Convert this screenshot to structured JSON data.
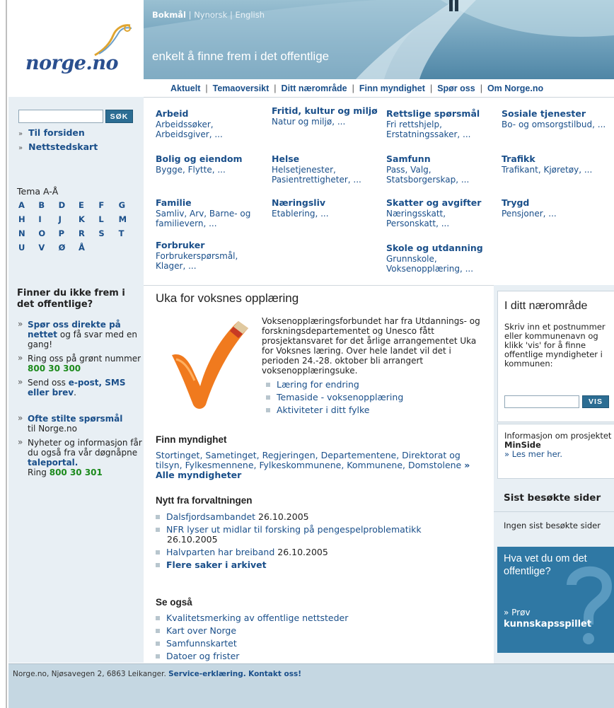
{
  "header": {
    "logo_text": "norge.no",
    "languages": [
      {
        "label": "Bokmål",
        "active": true
      },
      {
        "label": "Nynorsk",
        "active": false
      },
      {
        "label": "English",
        "active": false
      }
    ],
    "lang_sep": "|",
    "tagline": "enkelt å finne frem i det offentlige",
    "nav": [
      "Aktuelt",
      "Temaoversikt",
      "Ditt nærområde",
      "Finn myndighet",
      "Spør oss",
      "Om Norge.no"
    ],
    "nav_sep": "|"
  },
  "sidebar": {
    "search_button": "SØK",
    "search_placeholder": "",
    "links": [
      "Til forsiden",
      "Nettstedskart"
    ],
    "link_bullet": "»",
    "tema_title": "Tema A-Å",
    "letters": [
      "A",
      "B",
      "D",
      "E",
      "F",
      "G",
      "H",
      "I",
      "J",
      "K",
      "L",
      "M",
      "N",
      "O",
      "P",
      "R",
      "S",
      "T",
      "U",
      "V",
      "Ø",
      "Å"
    ],
    "finner_title": "Finner du ikke frem i det offentlige?",
    "help1_link": "Spør oss direkte på nettet",
    "help1_text": " og få svar med en gang!",
    "help2_text": "Ring oss på grønt nummer ",
    "help2_num": "800 30 300",
    "help3_text": "Send oss ",
    "help3_link": "e-post, SMS eller brev",
    "help3_end": ".",
    "faq_link": "Ofte stilte spørsmål",
    "faq_text": "til Norge.no",
    "news_text": "Nyheter og informasjon får du også fra vår døgnåpne ",
    "news_link": "taleportal.",
    "news_ring": "Ring ",
    "news_num": "800 30 301"
  },
  "topics": [
    {
      "title": "Arbeid",
      "sub": "Arbeidssøker, Arbeidsgiver, ..."
    },
    {
      "title": "Fritid, kultur og miljø",
      "sub": "Natur og miljø, ..."
    },
    {
      "title": "Rettslige spørsmål",
      "sub": "Fri rettshjelp, Erstatningssaker, ..."
    },
    {
      "title": "Sosiale tjenester",
      "sub": "Bo- og omsorgstilbud, ..."
    },
    {
      "title": "Bolig og eiendom",
      "sub": "Bygge, Flytte, ..."
    },
    {
      "title": "Helse",
      "sub": "Helsetjenester, Pasientrettigheter, ..."
    },
    {
      "title": "Samfunn",
      "sub": "Pass, Valg, Statsborgerskap, ..."
    },
    {
      "title": "Trafikk",
      "sub": "Trafikant, Kjøretøy, ..."
    },
    {
      "title": "Familie",
      "sub": "Samliv, Arv, Barne- og familievern, ..."
    },
    {
      "title": "Næringsliv",
      "sub": "Etablering, ..."
    },
    {
      "title": "Skatter og avgifter",
      "sub": "Næringsskatt, Personskatt, ..."
    },
    {
      "title": "Trygd",
      "sub": "Pensjoner, ..."
    },
    {
      "title": "Forbruker",
      "sub": "Forbrukerspørsmål, Klager, ..."
    },
    {
      "title": "Skole og utdanning",
      "sub": "Grunnskole, Voksenopplæring, ..."
    }
  ],
  "feature": {
    "title": "Uka for voksnes opplæring",
    "text": "Voksenopplæringsforbundet har fra Utdannings- og forskningsdepartementet og Unesco fått prosjektansvaret for det årlige arrangementet Uka for Voksnes læring. Over hele landet vil det i perioden 24.-28. oktober bli arrangert voksenopplæringsuke.",
    "links": [
      "Læring for endring",
      "Temaside - voksenopplæring",
      "Aktiviteter i ditt fylke"
    ]
  },
  "finn": {
    "title": "Finn myndighet",
    "text": "Stortinget, Sametinget, Regjeringen, Departementene, Direktorat og tilsyn, Fylkesmennene, Fylkeskommunene, Kommunene, Domstolene",
    "all_link": "» Alle myndigheter"
  },
  "nytt": {
    "title": "Nytt fra forvaltningen",
    "items": [
      {
        "link": "Dalsfjordsambandet",
        "date": "26.10.2005"
      },
      {
        "link": "NFR lyser ut midlar til forsking på pengespelproblematikk",
        "date": "26.10.2005"
      },
      {
        "link": "Halvparten har breiband",
        "date": "26.10.2005"
      }
    ],
    "more": "Flere saker i arkivet"
  },
  "seogsa": {
    "title": "Se også",
    "items": [
      "Kvalitetsmerking av offentlige nettsteder",
      "Kart over Norge",
      "Samfunnskartet",
      "Datoer og frister"
    ]
  },
  "right": {
    "naer_title": "I ditt nærområde",
    "naer_text": "Skriv inn et postnummer eller kommunenavn og klikk 'vis' for å finne offentlige myndigheter i kommunen:",
    "vis_button": "VIS",
    "minside_text": "Informasjon om prosjektet ",
    "minside_bold": "MinSide",
    "minside_link": "» Les mer her.",
    "sist_title": "Sist besøkte sider",
    "sist_text": "Ingen sist besøkte sider",
    "quiz_q": "Hva vet du om det offentlige?",
    "quiz_prov": "» Prøv",
    "quiz_link": "kunnskapsspillet"
  },
  "footer": {
    "address": "Norge.no, Njøsavegen 2, 6863 Leikanger. ",
    "service_link": "Service-erklæring.",
    "contact_link": "Kontakt oss!"
  },
  "colors": {
    "link": "#1a4f8a",
    "sidebar_bg": "#e8eff4",
    "banner": "#6e9fba",
    "green": "#1c8a1c",
    "quiz_bg": "#2f78a4"
  }
}
